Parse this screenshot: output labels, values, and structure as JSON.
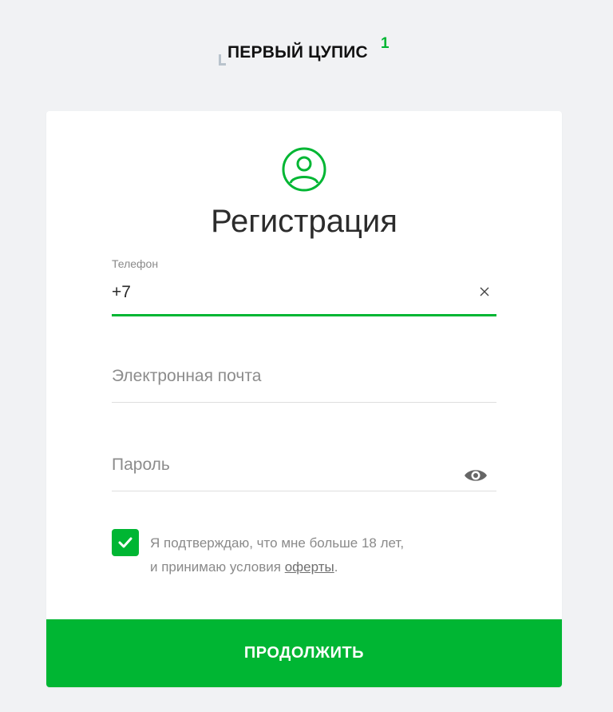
{
  "logo": {
    "text": "ПЕРВЫЙ ЦУПИС",
    "sup": "1"
  },
  "form": {
    "title": "Регистрация",
    "phone": {
      "label": "Телефон",
      "value": "+7"
    },
    "email": {
      "placeholder": "Электронная почта"
    },
    "password": {
      "placeholder": "Пароль"
    },
    "consent": {
      "checked": true,
      "line1": "Я подтверждаю, что мне больше 18 лет,",
      "line2_prefix": "и принимаю условия ",
      "link": "оферты",
      "line2_suffix": "."
    },
    "submit_label": "ПРОДОЛЖИТЬ"
  },
  "colors": {
    "accent": "#00b633",
    "background": "#f1f2f4"
  },
  "icons": [
    "user-circle-icon",
    "close-icon",
    "eye-icon",
    "check-icon"
  ]
}
